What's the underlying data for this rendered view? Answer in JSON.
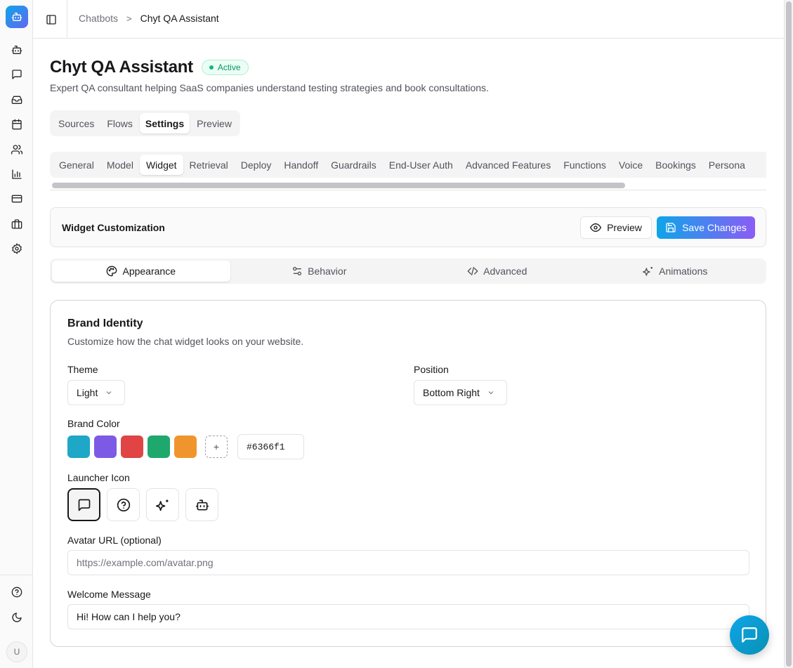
{
  "breadcrumb": {
    "parent": "Chatbots",
    "separator": ">",
    "current": "Chyt QA Assistant"
  },
  "page": {
    "title": "Chyt QA Assistant",
    "status": "Active",
    "description": "Expert QA consultant helping SaaS companies understand testing strategies and book consultations."
  },
  "main_tabs": [
    {
      "label": "Sources"
    },
    {
      "label": "Flows"
    },
    {
      "label": "Settings",
      "active": true
    },
    {
      "label": "Preview"
    }
  ],
  "settings_tabs": [
    {
      "label": "General"
    },
    {
      "label": "Model"
    },
    {
      "label": "Widget",
      "active": true
    },
    {
      "label": "Retrieval"
    },
    {
      "label": "Deploy"
    },
    {
      "label": "Handoff"
    },
    {
      "label": "Guardrails"
    },
    {
      "label": "End-User Auth"
    },
    {
      "label": "Advanced Features"
    },
    {
      "label": "Functions"
    },
    {
      "label": "Voice"
    },
    {
      "label": "Bookings"
    },
    {
      "label": "Persona"
    }
  ],
  "widget_card": {
    "title": "Widget Customization",
    "preview_label": "Preview",
    "save_label": "Save Changes"
  },
  "section_tabs": [
    {
      "label": "Appearance",
      "icon": "palette-icon",
      "active": true
    },
    {
      "label": "Behavior",
      "icon": "sliders-icon"
    },
    {
      "label": "Advanced",
      "icon": "code-icon"
    },
    {
      "label": "Animations",
      "icon": "sparkles-icon"
    }
  ],
  "brand": {
    "title": "Brand Identity",
    "description": "Customize how the chat widget looks on your website.",
    "theme_label": "Theme",
    "theme_value": "Light",
    "position_label": "Position",
    "position_value": "Bottom Right",
    "color_label": "Brand Color",
    "swatches": [
      "#1ea7c6",
      "#7c5ae6",
      "#e04444",
      "#1fa86e",
      "#f0952e"
    ],
    "add_symbol": "+",
    "hex_value": "#6366f1",
    "launcher_label": "Launcher Icon",
    "launcher_icons": [
      "message-square-icon",
      "help-circle-icon",
      "sparkles-icon",
      "bot-icon"
    ],
    "avatar_label": "Avatar URL (optional)",
    "avatar_placeholder": "https://example.com/avatar.png",
    "welcome_label": "Welcome Message",
    "welcome_value": "Hi! How can I help you?"
  },
  "user": {
    "initial": "U"
  },
  "colors": {
    "accent_start": "#0ea5e9",
    "accent_end": "#8b5cf6",
    "active_green": "#10b981"
  }
}
